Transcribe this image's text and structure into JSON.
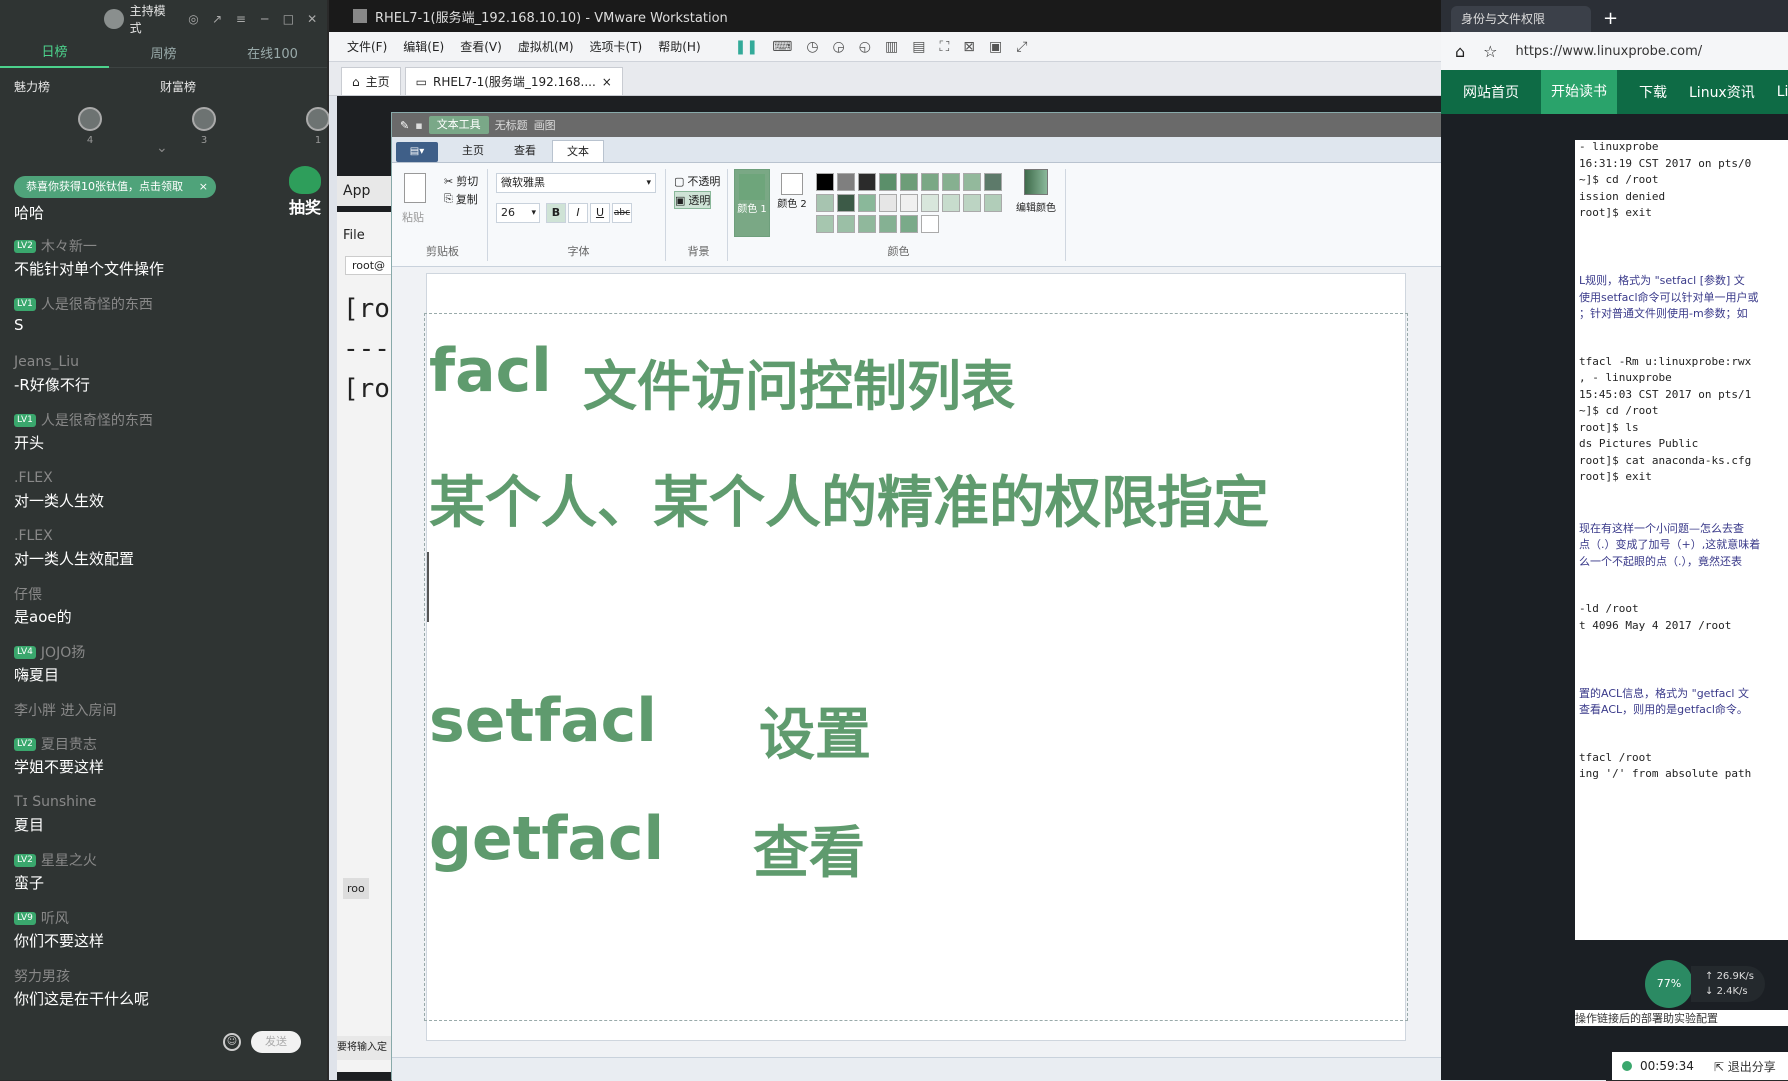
{
  "chat": {
    "mode_label": "主持模式",
    "tabs": [
      "日榜",
      "周榜",
      "在线100"
    ],
    "rank_heads": [
      "魅力榜",
      "财富榜"
    ],
    "rank_counts": [
      "4",
      "3",
      "1"
    ],
    "banner": "恭喜你获得10张钛值，点击领取",
    "lottery": "抽奖",
    "messages": [
      {
        "user": "",
        "level": "",
        "text": "哈哈"
      },
      {
        "user": "木々新一",
        "level": "LV2",
        "text": "不能针对单个文件操作"
      },
      {
        "user": "人是很奇怪的东西",
        "level": "LV1",
        "text": "S"
      },
      {
        "user": "Jeans_Liu",
        "level": "",
        "text": "-R好像不行"
      },
      {
        "user": "人是很奇怪的东西",
        "level": "LV1",
        "text": "开头"
      },
      {
        "user": ".FLEX",
        "level": "",
        "text": "对一类人生效"
      },
      {
        "user": ".FLEX",
        "level": "",
        "text": "对一类人生效配置"
      },
      {
        "user": "仔偎",
        "level": "",
        "text": "是aoe的"
      },
      {
        "user": "JOJO扬",
        "level": "LV4",
        "text": "嗨夏目"
      },
      {
        "user": "李小胖 进入房间",
        "level": "",
        "text": ""
      },
      {
        "user": "夏目贵志",
        "level": "LV2",
        "text": "学姐不要这样"
      },
      {
        "user": "Tɪ Sunshine",
        "level": "",
        "text": "夏目"
      },
      {
        "user": "星星之火",
        "level": "LV2",
        "text": "蛮子"
      },
      {
        "user": "听风",
        "level": "LV9",
        "text": "你们不要这样"
      },
      {
        "user": "努力男孩",
        "level": "",
        "text": "你们这是在干什么呢"
      }
    ],
    "send_label": "发送"
  },
  "vmware": {
    "title": "RHEL7-1(服务端_192.168.10.10) - VMware Workstation",
    "menu": [
      "文件(F)",
      "编辑(E)",
      "查看(V)",
      "虚拟机(M)",
      "选项卡(T)",
      "帮助(H)"
    ],
    "tabs": [
      "主页",
      "RHEL7-1(服务端_192.168...."
    ],
    "bg_labels": {
      "app": "App",
      "file": "File",
      "root_tab": "root@",
      "term_lines": [
        "[ro",
        "---",
        "[ro"
      ],
      "taskbar_item": "roo",
      "taskbar_hint": "要将输入定"
    }
  },
  "paint": {
    "context_tab": "文本工具",
    "title_extra": [
      "无标题",
      "画图"
    ],
    "ribbon_tabs": [
      "主页",
      "查看",
      "文本"
    ],
    "active_tab": "文本",
    "clipboard": {
      "paste": "粘贴",
      "cut": "剪切",
      "copy": "复制",
      "label": "剪贴板"
    },
    "font": {
      "family": "微软雅黑",
      "size": "26",
      "label": "字体",
      "bold": "B",
      "italic": "I",
      "underline": "U",
      "strike": "abc"
    },
    "background": {
      "opaque": "不透明",
      "transparent": "透明",
      "label": "背景"
    },
    "colors": {
      "color1": "颜色 1",
      "color2": "颜色 2",
      "edit": "编辑颜色",
      "label": "颜色",
      "color1_hex": "#6ea57b",
      "color2_hex": "#ffffff"
    },
    "palette": [
      "#000000",
      "#7f7f7f",
      "#2b2b2b",
      "#5b8f6a",
      "#6d9d78",
      "#7aa885",
      "#86b090",
      "#93b99c",
      "#5d7a6a",
      "#a7c4b0",
      "#3c5a47",
      "#8ab89a",
      "#e6e6e6",
      "#f0f0f0",
      "#d8e6dc",
      "#c7dccd",
      "#bcd4c3",
      "#b1cdb9",
      "#a6c6af",
      "#9bbfa6",
      "#90b89c",
      "#85b193",
      "#7aaa89",
      "#ffffff"
    ],
    "canvas_text": {
      "line1_en": "facl",
      "line1_zh": "文件访问控制列表",
      "line2": "某个人、某个人的精准的权限指定",
      "line3_en": "setfacl",
      "line3_zh": "设置",
      "line4_en": "getfacl",
      "line4_zh": "查看"
    }
  },
  "browser": {
    "tab_title": "身份与文件权限",
    "url": "https://www.linuxprobe.com/",
    "nav": [
      "网站首页",
      "开始读书",
      "下载",
      "Linux资讯",
      "Linu"
    ],
    "nav_active": "开始读书",
    "term_lines": [
      "- linuxprobe",
      "16:31:19 CST 2017 on pts/0",
      "~]$ cd /root",
      "ission denied",
      "root]$ exit",
      "",
      "",
      "",
      "L规则，格式为 \"setfacl [参数] 文",
      "使用setfacl命令可以针对单一用户或",
      "；针对普通文件则使用-m参数；如",
      "",
      "",
      "tfacl -Rm u:linuxprobe:rwx",
      ", - linuxprobe",
      "15:45:03 CST 2017 on pts/1",
      "~]$ cd /root",
      "root]$ ls",
      "ds Pictures Public",
      "root]$ cat anaconda-ks.cfg",
      "root]$ exit",
      "",
      "",
      "现在有这样一个小问题—怎么去查",
      "点（.）变成了加号（+）,这就意味着",
      "么一个不起眼的点（.），竟然还表",
      "",
      "",
      "-ld /root",
      "t 4096 May 4 2017 /root",
      "",
      "",
      "",
      "置的ACL信息，格式为 \"getfacl 文",
      "查看ACL，则用的是getfacl命令。",
      "",
      "",
      "tfacl /root",
      "ing '/' from absolute path"
    ],
    "net_percent": "77%",
    "net_up": "26.9K/s",
    "net_down": "2.4K/s",
    "bottom_snippet": "操作链接后的部署助实验配置",
    "timer": "00:59:34",
    "exit_share": "退出分享"
  }
}
